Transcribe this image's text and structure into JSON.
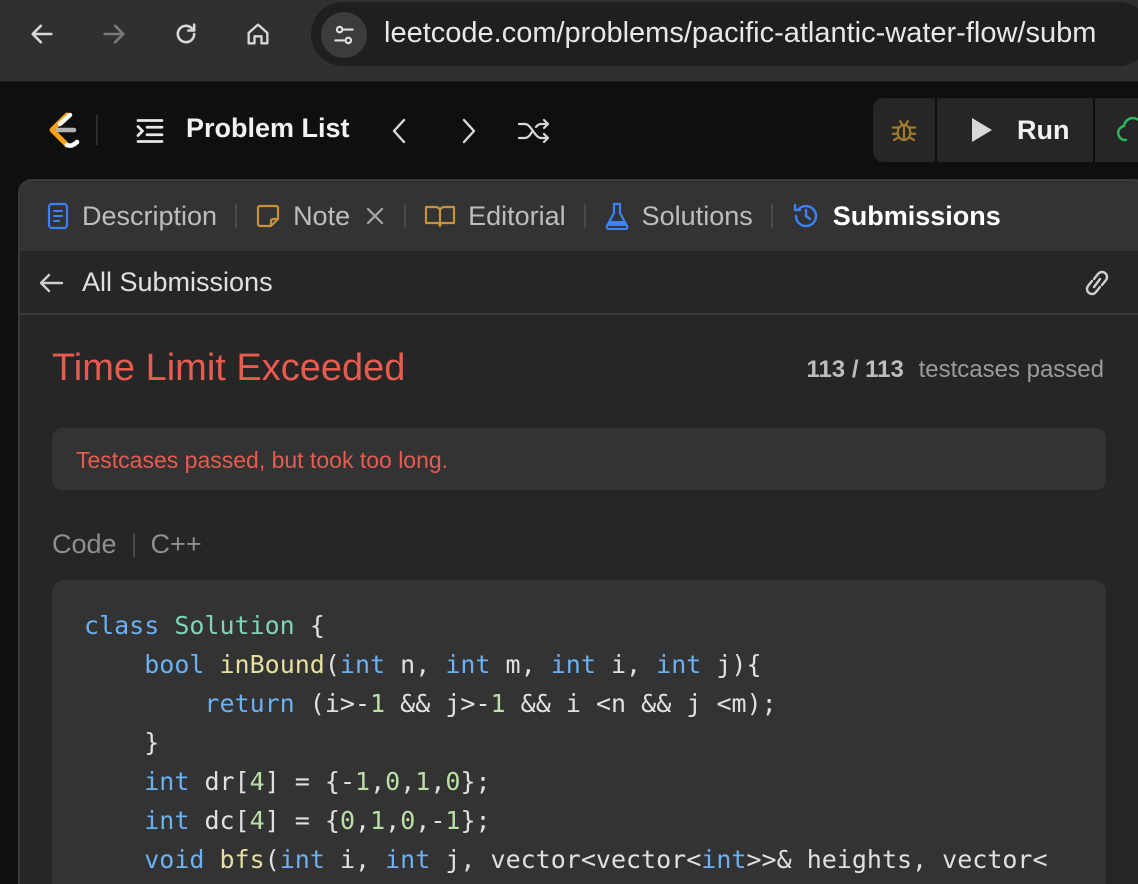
{
  "browser": {
    "url": "leetcode.com/problems/pacific-atlantic-water-flow/subm"
  },
  "header": {
    "problem_list_label": "Problem List",
    "run_label": "Run"
  },
  "tabs": [
    {
      "label": "Description",
      "active": false
    },
    {
      "label": "Note",
      "active": false,
      "closable": true
    },
    {
      "label": "Editorial",
      "active": false
    },
    {
      "label": "Solutions",
      "active": false
    },
    {
      "label": "Submissions",
      "active": true
    }
  ],
  "submission": {
    "back_label": "All Submissions",
    "status": "Time Limit Exceeded",
    "testcases_count": "113 / 113",
    "testcases_label": "testcases passed",
    "message": "Testcases passed, but took too long.",
    "code_label": "Code",
    "language": "C++"
  },
  "code_lines": [
    "class Solution {",
    "    bool inBound(int n, int m, int i, int j){",
    "        return (i>-1 && j>-1 && i <n && j <m);",
    "    }",
    "    int dr[4] = {-1,0,1,0};",
    "    int dc[4] = {0,1,0,-1};",
    "    void bfs(int i, int j, vector<vector<int>>& heights, vector<"
  ],
  "colors": {
    "status_red": "#e85b4f",
    "accent_blue": "#3b82f6",
    "submit_green": "#2cbb5d",
    "note_orange": "#c8923a"
  }
}
